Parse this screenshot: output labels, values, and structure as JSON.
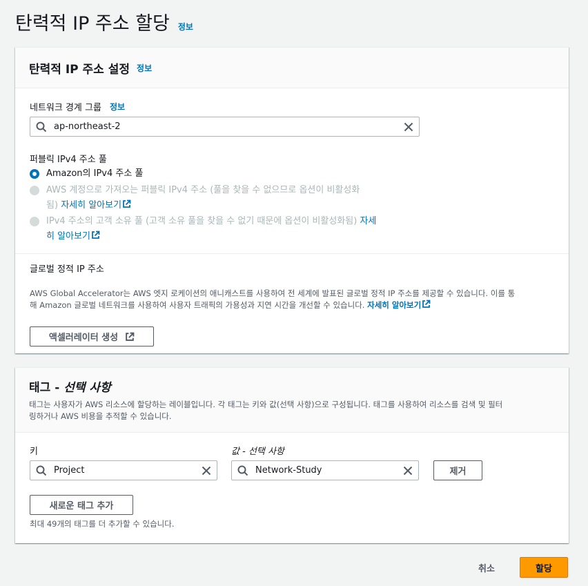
{
  "page": {
    "title": "탄력적 IP 주소 할당",
    "info": "정보"
  },
  "settings": {
    "title": "탄력적 IP 주소 설정",
    "info": "정보",
    "network_border_group": {
      "label": "네트워크 경계 그룹",
      "info": "정보",
      "value": "ap-northeast-2"
    },
    "ipv4_pool": {
      "label": "퍼블릭 IPv4 주소 풀",
      "options": [
        {
          "text": "Amazon의 IPv4 주소 풀",
          "selected": true,
          "disabled": false
        },
        {
          "text_line1": "AWS 계정으로 가져오는 퍼블릭 IPv4 주소 (풀을 찾을 수 없으므로 옵션이 비활성화",
          "text_line2": "됨)",
          "link": "자세히 알아보기",
          "selected": false,
          "disabled": true
        },
        {
          "text_line1": "IPv4 주소의 고객 소유 풀 (고객 소유 풀을 찾을 수 없기 때문에 옵션이 비활성화됨)",
          "link_line1": "자세",
          "link_line2": "히 알아보기",
          "selected": false,
          "disabled": true
        }
      ]
    },
    "global_static": {
      "label": "글로벌 정적 IP 주소",
      "desc_line1": "AWS Global Accelerator는 AWS 엣지 로케이션의 애니캐스트를 사용하여 전 세계에 발표된 글로벌 정적 IP 주소를 제공할 수 있습니다. 이를 통",
      "desc_line2": "해 Amazon 글로벌 네트워크를 사용하여 사용자 트래픽의 가용성과 지연 시간을 개선할 수 있습니다.",
      "learn_more": "자세히 알아보기",
      "button": "액셀러레이터 생성"
    }
  },
  "tags": {
    "title_main": "태그 - ",
    "title_italic": "선택 사항",
    "desc_line1": "태그는 사용자가 AWS 리소스에 할당하는 레이블입니다. 각 태그는 키와 값(선택 사항)으로 구성됩니다. 태그를 사용하여 리소스를 검색 및 필터",
    "desc_line2": "링하거나 AWS 비용을 추적할 수 있습니다.",
    "key_label": "키",
    "value_label": "값 - 선택 사항",
    "key_value": "Project",
    "value_value": "Network-Study",
    "remove_button": "제거",
    "add_button": "새로운 태그 추가",
    "limit_text": "최대 49개의 태그를 더 추가할 수 있습니다."
  },
  "footer": {
    "cancel": "취소",
    "allocate": "할당"
  },
  "colors": {
    "primary": "#ff9900",
    "link": "#0073bb",
    "radio_selected": "#0073bb"
  }
}
